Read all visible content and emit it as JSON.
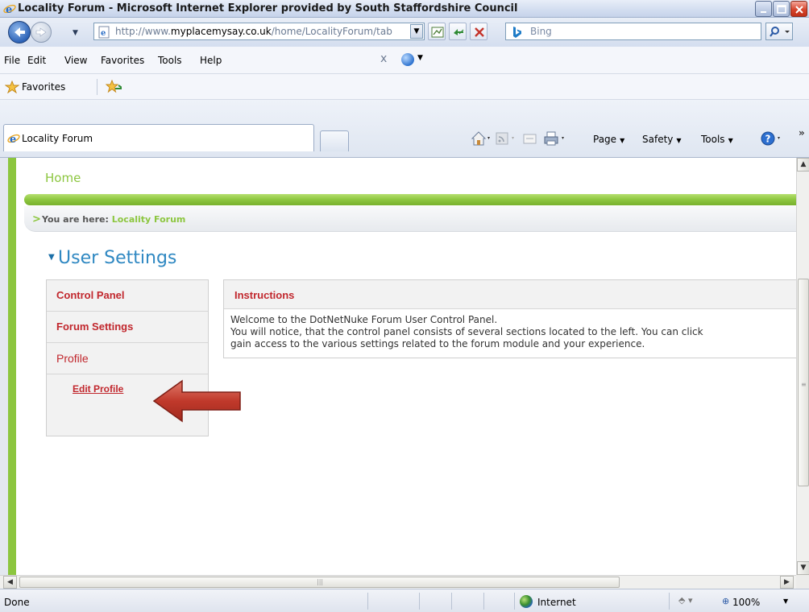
{
  "window": {
    "title": "Locality Forum - Microsoft Internet Explorer provided by South Staffordshire Council"
  },
  "address_bar": {
    "url_prefix": "http://www.",
    "url_domain": "myplacemysay.co.uk",
    "url_path": "/home/LocalityForum/tab",
    "search_placeholder": "Bing"
  },
  "menu": {
    "items": [
      "File",
      "Edit",
      "View",
      "Favorites",
      "Tools",
      "Help"
    ]
  },
  "favorites_bar": {
    "label": "Favorites"
  },
  "tabs": {
    "active_label": "Locality Forum"
  },
  "command_bar": {
    "page_label": "Page",
    "safety_label": "Safety",
    "tools_label": "Tools"
  },
  "page": {
    "home_link": "Home",
    "breadcrumb_prefix": "You are here:",
    "breadcrumb_current": "Locality Forum",
    "section_title": "User Settings",
    "control_panel": {
      "items": [
        "Control Panel",
        "Forum Settings",
        "Profile"
      ],
      "sub_item": "Edit Profile"
    },
    "instructions": {
      "heading": "Instructions",
      "lines": [
        "Welcome to the DotNetNuke Forum User Control Panel.",
        "You will notice, that the control panel consists of several sections located to the left. You can click",
        "gain access to the various settings related to the forum module and your experience."
      ]
    }
  },
  "status_bar": {
    "status": "Done",
    "zone": "Internet",
    "zoom": "100%"
  },
  "colors": {
    "accent_green": "#8cc63f",
    "link_red": "#c1272d",
    "title_blue": "#2f88c2",
    "callout_arrow": "#c0392b"
  }
}
